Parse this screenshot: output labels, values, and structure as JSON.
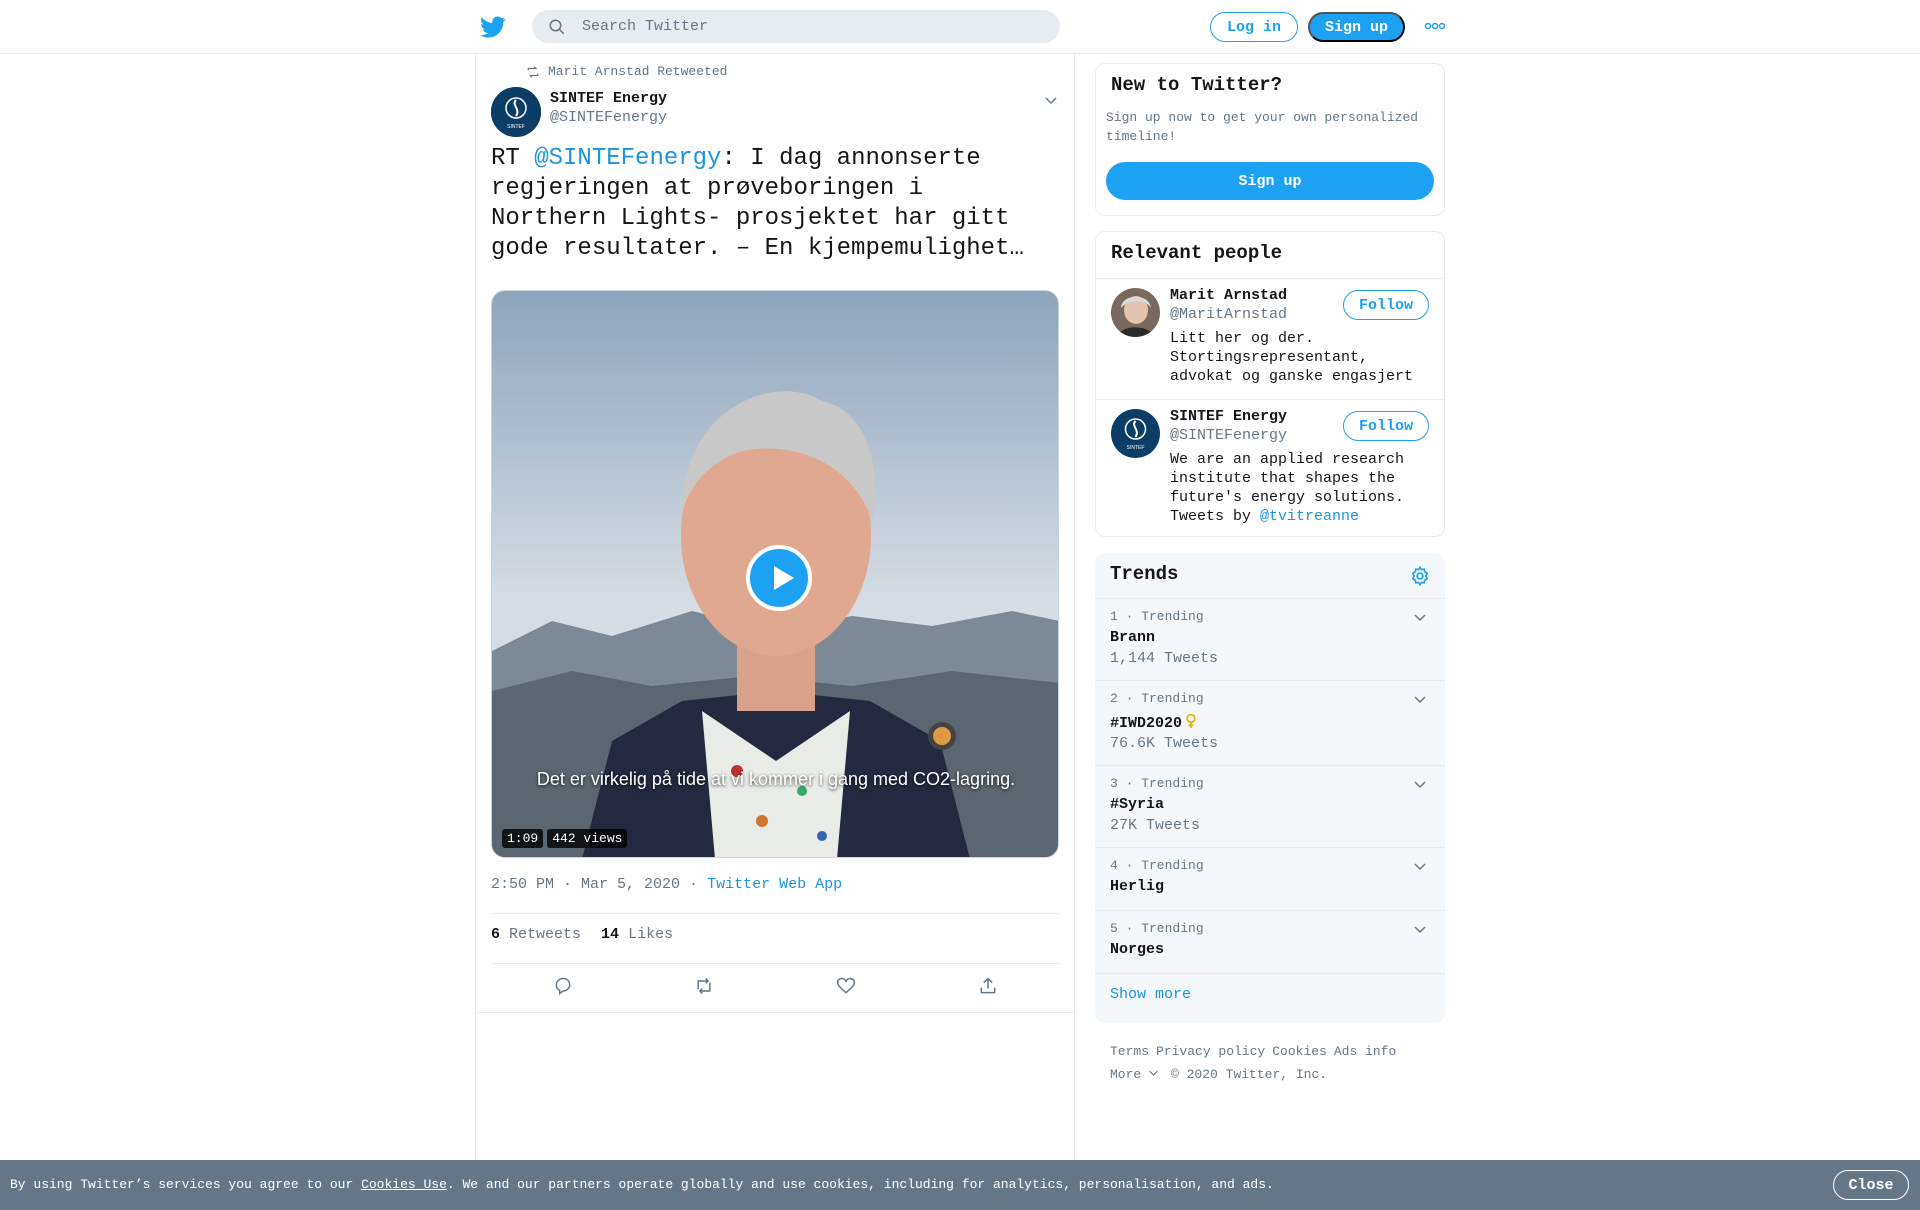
{
  "header": {
    "search_placeholder": "Search Twitter",
    "login_label": "Log in",
    "signup_label": "Sign up"
  },
  "tweet": {
    "retweeted_by": "Marit Arnstad Retweeted",
    "author_name": "SINTEF Energy",
    "author_handle": "@SINTEFenergy",
    "text_prefix": "RT ",
    "text_mention": "@SINTEFenergy",
    "text_body": ": I dag annonserte regjeringen at prøveboringen i Northern Lights- prosjektet har gitt gode resultater. – En kjempemulighet…",
    "video_subtitle": "Det er virkelig på tide at vi kommer i gang med CO2-lagring.",
    "video_duration": "1:09",
    "video_views": "442 views",
    "timestamp": "2:50 PM · Mar 5, 2020 ·",
    "source": "Twitter Web App",
    "retweets_count": "6",
    "retweets_label": "Retweets",
    "likes_count": "14",
    "likes_label": "Likes"
  },
  "sidebar": {
    "new_title": "New to Twitter?",
    "new_text": "Sign up now to get your own personalized timeline!",
    "new_signup": "Sign up",
    "people_title": "Relevant people",
    "people": [
      {
        "name": "Marit Arnstad",
        "handle": "@MaritArnstad",
        "follow": "Follow",
        "bio": "Litt her og der. Stortingsrepresentant, advokat og ganske engasjert"
      },
      {
        "name": "SINTEF Energy",
        "handle": "@SINTEFenergy",
        "follow": "Follow",
        "bio": "We are an applied research institute that shapes the future's energy solutions. Tweets by ",
        "bio_mention": "@tvitreanne"
      }
    ],
    "trends_title": "Trends",
    "trends": [
      {
        "meta": "1 · Trending",
        "name": "Brann",
        "count": "1,144 Tweets"
      },
      {
        "meta": "2 · Trending",
        "name": "#IWD2020",
        "count": "76.6K Tweets"
      },
      {
        "meta": "3 · Trending",
        "name": "#Syria",
        "count": "27K Tweets"
      },
      {
        "meta": "4 · Trending",
        "name": "Herlig",
        "count": ""
      },
      {
        "meta": "5 · Trending",
        "name": "Norges",
        "count": ""
      }
    ],
    "show_more": "Show more",
    "footer": {
      "terms": "Terms",
      "privacy": "Privacy policy",
      "cookies": "Cookies",
      "ads": "Ads info",
      "more": "More",
      "copyright": "© 2020 Twitter, Inc."
    }
  },
  "cookie_bar": {
    "text_before": "By using Twitter’s services you agree to our ",
    "link": "Cookies Use",
    "text_after": ". We and our partners operate globally and use cookies, including for analytics, personalisation, and ads.",
    "close": "Close"
  },
  "colors": {
    "brand": "#1da1f2",
    "link": "#1b95e0",
    "muted": "#657786",
    "cookie_bg": "#657786"
  }
}
